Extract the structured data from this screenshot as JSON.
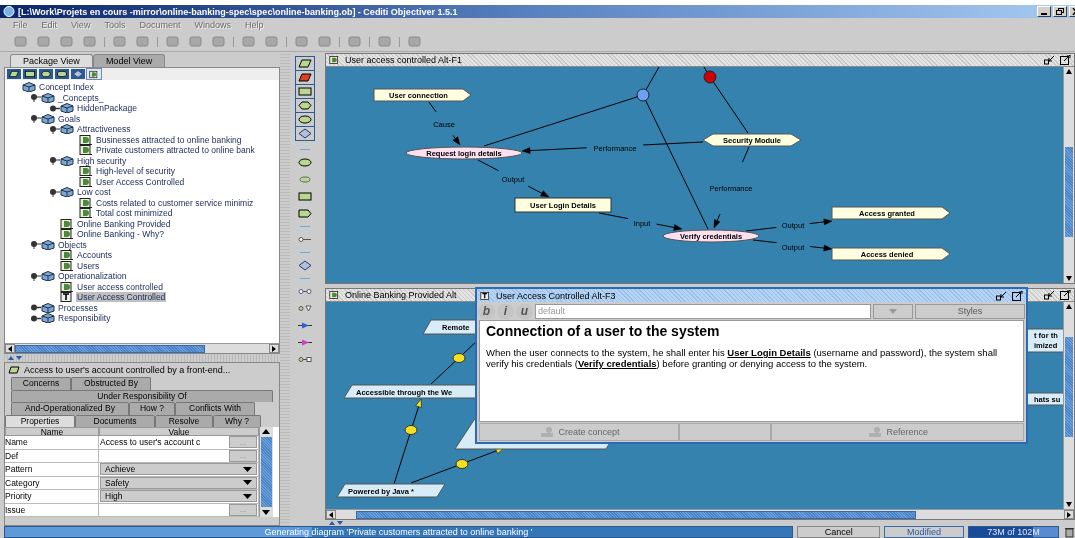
{
  "window": {
    "title": "[L:\\Work\\Projets en cours -mirror\\online-banking-spec\\spec\\online-banking.ob] - Cediti Objectiver 1.5.1"
  },
  "menu": [
    {
      "label": "File",
      "disabled": true
    },
    {
      "label": "Edit",
      "disabled": true
    },
    {
      "label": "View",
      "disabled": true
    },
    {
      "label": "Tools",
      "disabled": true
    },
    {
      "label": "Document",
      "disabled": true
    },
    {
      "label": "Windows",
      "disabled": true
    },
    {
      "label": "Help",
      "disabled": true
    }
  ],
  "left_tabs": [
    {
      "label": "Package View",
      "selected": true
    },
    {
      "label": "Model View",
      "selected": false
    }
  ],
  "tree": [
    {
      "label": "Concept Index",
      "kind": "package",
      "selected": false,
      "children": [
        {
          "label": "_Concepts_",
          "kind": "package",
          "expanded": true,
          "selected": false,
          "children": [
            {
              "label": "HiddenPackage",
              "kind": "package",
              "expanded": false,
              "selected": false
            }
          ]
        },
        {
          "label": "Goals",
          "kind": "package",
          "expanded": true,
          "selected": false,
          "children": [
            {
              "label": "Attractiveness",
              "kind": "package",
              "expanded": true,
              "selected": false,
              "children": [
                {
                  "label": "Businesses attracted to online banking",
                  "kind": "concept",
                  "selected": false
                },
                {
                  "label": "Private customers attracted to online bank",
                  "kind": "concept",
                  "selected": false
                }
              ]
            },
            {
              "label": "High security",
              "kind": "package",
              "expanded": true,
              "selected": false,
              "children": [
                {
                  "label": "High-level of security",
                  "kind": "concept",
                  "selected": false
                },
                {
                  "label": "User Access Controlled",
                  "kind": "concept",
                  "selected": false
                }
              ]
            },
            {
              "label": "Low cost",
              "kind": "package",
              "expanded": true,
              "selected": false,
              "children": [
                {
                  "label": "Costs related to customer service minimiz",
                  "kind": "concept",
                  "selected": false
                },
                {
                  "label": "Total cost minimized",
                  "kind": "concept",
                  "selected": false
                }
              ]
            },
            {
              "label": "Online Banking Provided",
              "kind": "concept",
              "selected": false
            },
            {
              "label": "Online Banking - Why?",
              "kind": "concept",
              "selected": false
            }
          ]
        },
        {
          "label": "Objects",
          "kind": "package",
          "expanded": true,
          "selected": false,
          "children": [
            {
              "label": "Accounts",
              "kind": "concept",
              "selected": false
            },
            {
              "label": "Users",
              "kind": "concept",
              "selected": false
            }
          ]
        },
        {
          "label": "Operationalization",
          "kind": "package",
          "expanded": true,
          "selected": false,
          "children": [
            {
              "label": "User access controlled",
              "kind": "concept",
              "selected": false
            },
            {
              "label": "User Access Controlled",
              "kind": "text",
              "selected": true
            }
          ]
        },
        {
          "label": "Processes",
          "kind": "package",
          "expanded": false,
          "selected": false
        },
        {
          "label": "Responsibility",
          "kind": "package",
          "expanded": false,
          "selected": false
        }
      ]
    }
  ],
  "properties": {
    "title": "Access to user's account controlled by a front-end...",
    "tab_rows": [
      [
        {
          "label": "Concerns",
          "selected": false
        },
        {
          "label": "Obstructed By",
          "selected": false
        }
      ],
      [
        {
          "label": "Under Responsibility Of",
          "selected": false
        }
      ],
      [
        {
          "label": "And-Operationalized By",
          "selected": false
        },
        {
          "label": "How ?",
          "selected": false
        },
        {
          "label": "Conflicts With",
          "selected": false
        }
      ],
      [
        {
          "label": "Properties",
          "selected": true
        },
        {
          "label": "Documents",
          "selected": false
        },
        {
          "label": "Resolve",
          "selected": false
        },
        {
          "label": "Why ?",
          "selected": false
        }
      ]
    ],
    "columns": [
      "Name",
      "Value"
    ],
    "rows": [
      {
        "name": "Name",
        "kind": "text",
        "value": "Access to user's account c",
        "button": "..."
      },
      {
        "name": "Def",
        "kind": "text",
        "button": "..."
      },
      {
        "name": "Pattern",
        "kind": "choice",
        "value": "Achieve"
      },
      {
        "name": "Category",
        "kind": "choice",
        "value": "Safety"
      },
      {
        "name": "Priority",
        "kind": "choice",
        "value": "High"
      },
      {
        "name": "Issue",
        "kind": "text",
        "button": "..."
      }
    ]
  },
  "diagram_top": {
    "title": "User access controlled  Alt-F1",
    "nodes": [
      {
        "label": "User connection",
        "kind": "event"
      },
      {
        "label": "Request login details",
        "kind": "operation"
      },
      {
        "label": "Security Module",
        "kind": "agent"
      },
      {
        "label": "User Login Details",
        "kind": "entity"
      },
      {
        "label": "Verify credentials",
        "kind": "operation"
      },
      {
        "label": "Access granted",
        "kind": "event"
      },
      {
        "label": "Access denied",
        "kind": "event"
      }
    ],
    "junctions": [
      {
        "color": "#6f9ff0"
      },
      {
        "color": "#cc0000"
      }
    ],
    "edges": [
      {
        "label": "Cause"
      },
      {
        "label": "Performance"
      },
      {
        "label": "Output"
      },
      {
        "label": "Input"
      },
      {
        "label": "Performance"
      },
      {
        "label": "Output"
      },
      {
        "label": "Output"
      }
    ]
  },
  "diagram_bottom": {
    "title": "Online Banking Provided  Alt",
    "nodes": [
      {
        "lines": [
          "Remote"
        ]
      },
      {
        "lines": [
          "Accessible through the We"
        ]
      },
      {
        "lines": [
          "Powered by Java *"
        ]
      },
      {
        "lines": [
          "t for th",
          "imized"
        ]
      },
      {
        "lines": [
          "hats su"
        ]
      }
    ]
  },
  "editor": {
    "title": "User Access Controlled  Alt-F3",
    "format_buttons": [
      "b",
      "i",
      "u"
    ],
    "style_value": "default",
    "styles_button": "Styles",
    "heading": "Connection of a user to the system",
    "paragraph": [
      {
        "text": "When the user connects to the system, he shall enter his "
      },
      {
        "text": "User Login Details",
        "kind": "link"
      },
      {
        "text": " (username and password), the system shall verify his credentials ("
      },
      {
        "text": "Verify credentials",
        "kind": "link"
      },
      {
        "text": ") before granting or denying access to the system."
      }
    ],
    "actions": [
      {
        "label": "Create concept",
        "disabled": true
      },
      {
        "label": "Reference",
        "disabled": true
      }
    ]
  },
  "status": {
    "message": "Generating diagram 'Private customers attracted to online banking '",
    "progress": {
      "level": 0.39
    },
    "cancel": "Cancel",
    "state": "Modified",
    "memory": {
      "text": "73M of 102M",
      "level": 0.72
    }
  }
}
